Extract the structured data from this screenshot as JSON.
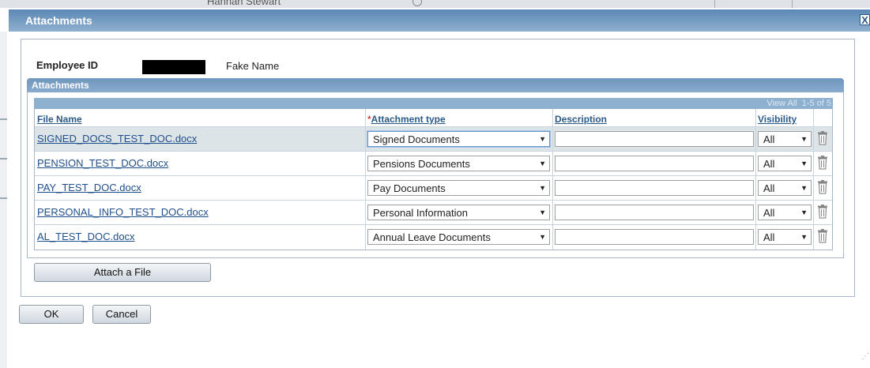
{
  "background": {
    "partial_text": "Hannah Stewart"
  },
  "dialog": {
    "title": "Attachments",
    "close_label": "X"
  },
  "employee": {
    "id_label": "Employee ID",
    "name": "Fake Name"
  },
  "attachments": {
    "section_title": "Attachments",
    "nav": {
      "view_all": "View All",
      "range": "1-5 of 5"
    },
    "columns": {
      "file_name": "File Name",
      "required_marker": "*",
      "attachment_type": "Attachment type",
      "description": "Description",
      "visibility": "Visibility"
    },
    "rows": [
      {
        "file_name": "SIGNED_DOCS_TEST_DOC.docx",
        "attachment_type": "Signed Documents",
        "description": "",
        "visibility": "All",
        "selected": true
      },
      {
        "file_name": "PENSION_TEST_DOC.docx",
        "attachment_type": "Pensions Documents",
        "description": "",
        "visibility": "All",
        "selected": false
      },
      {
        "file_name": "PAY_TEST_DOC.docx",
        "attachment_type": "Pay Documents",
        "description": "",
        "visibility": "All",
        "selected": false
      },
      {
        "file_name": "PERSONAL_INFO_TEST_DOC.docx",
        "attachment_type": "Personal Information",
        "description": "",
        "visibility": "All",
        "selected": false
      },
      {
        "file_name": "AL_TEST_DOC.docx",
        "attachment_type": "Annual Leave Documents",
        "description": "",
        "visibility": "All",
        "selected": false
      }
    ],
    "dropdown_arrow": "▼",
    "delete_icon": "trash-icon",
    "attach_button": "Attach a File"
  },
  "footer": {
    "ok": "OK",
    "cancel": "Cancel"
  },
  "colors": {
    "title_bar": "#5c88b5",
    "section_header": "#6f97bf",
    "link": "#1f4e8c",
    "selected_row": "#dde4e8"
  }
}
